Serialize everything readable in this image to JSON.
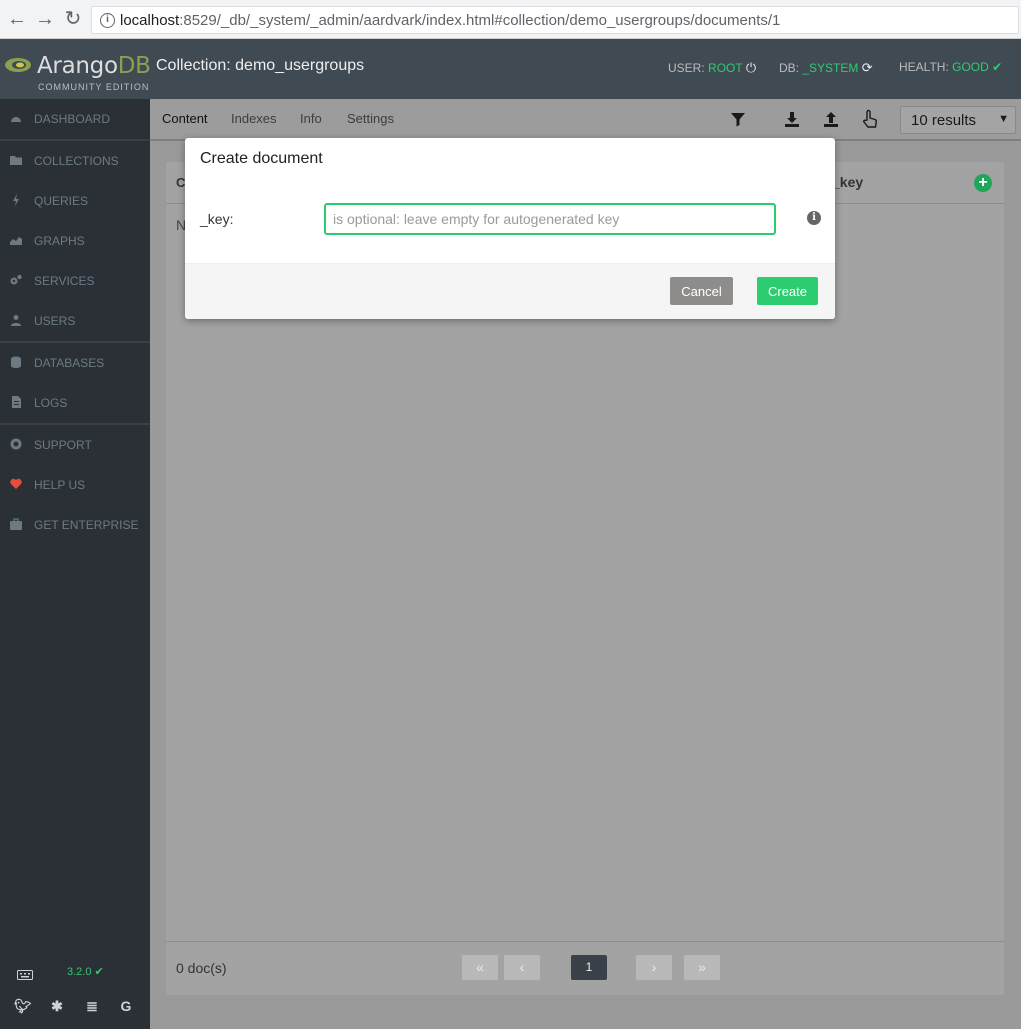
{
  "browser": {
    "url_host": "localhost",
    "url_rest": ":8529/_db/_system/_admin/aardvark/index.html#collection/demo_usergroups/documents/1"
  },
  "header": {
    "logo_arango": "Arango",
    "logo_db": "DB",
    "logo_sub": "COMMUNITY EDITION",
    "title": "Collection: demo_usergroups",
    "user_label": "USER:",
    "user_value": "ROOT",
    "db_label": "DB:",
    "db_value": "_SYSTEM",
    "health_label": "HEALTH:",
    "health_value": "GOOD"
  },
  "sidebar": {
    "items": [
      {
        "label": "DASHBOARD",
        "icon": "dashboard-icon"
      },
      {
        "label": "COLLECTIONS",
        "icon": "folder-icon"
      },
      {
        "label": "QUERIES",
        "icon": "bolt-icon"
      },
      {
        "label": "GRAPHS",
        "icon": "area-chart-icon"
      },
      {
        "label": "SERVICES",
        "icon": "cogs-icon"
      },
      {
        "label": "USERS",
        "icon": "users-icon"
      },
      {
        "label": "DATABASES",
        "icon": "database-icon"
      },
      {
        "label": "LOGS",
        "icon": "file-icon"
      },
      {
        "label": "SUPPORT",
        "icon": "lifebuoy-icon"
      },
      {
        "label": "HELP US",
        "icon": "heart-icon"
      },
      {
        "label": "GET ENTERPRISE",
        "icon": "briefcase-icon"
      }
    ],
    "version": "3.2.0"
  },
  "subnav": {
    "tabs": [
      "Content",
      "Indexes",
      "Info",
      "Settings"
    ],
    "results": "10 results"
  },
  "panel": {
    "col1": "C",
    "col2": "_key",
    "empty_text": "N",
    "doc_count": "0 doc(s)",
    "pagination": {
      "first": "«",
      "prev": "‹",
      "current": "1",
      "next": "›",
      "last": "»"
    }
  },
  "modal": {
    "title": "Create document",
    "key_label": "_key:",
    "key_placeholder": "is optional: leave empty for autogenerated key",
    "key_value": "",
    "cancel_label": "Cancel",
    "create_label": "Create"
  },
  "colors": {
    "accent_green": "#2ecc71",
    "header_bg": "#404a53",
    "sidebar_bg": "#2b3037",
    "logo_db": "#8aa051"
  }
}
